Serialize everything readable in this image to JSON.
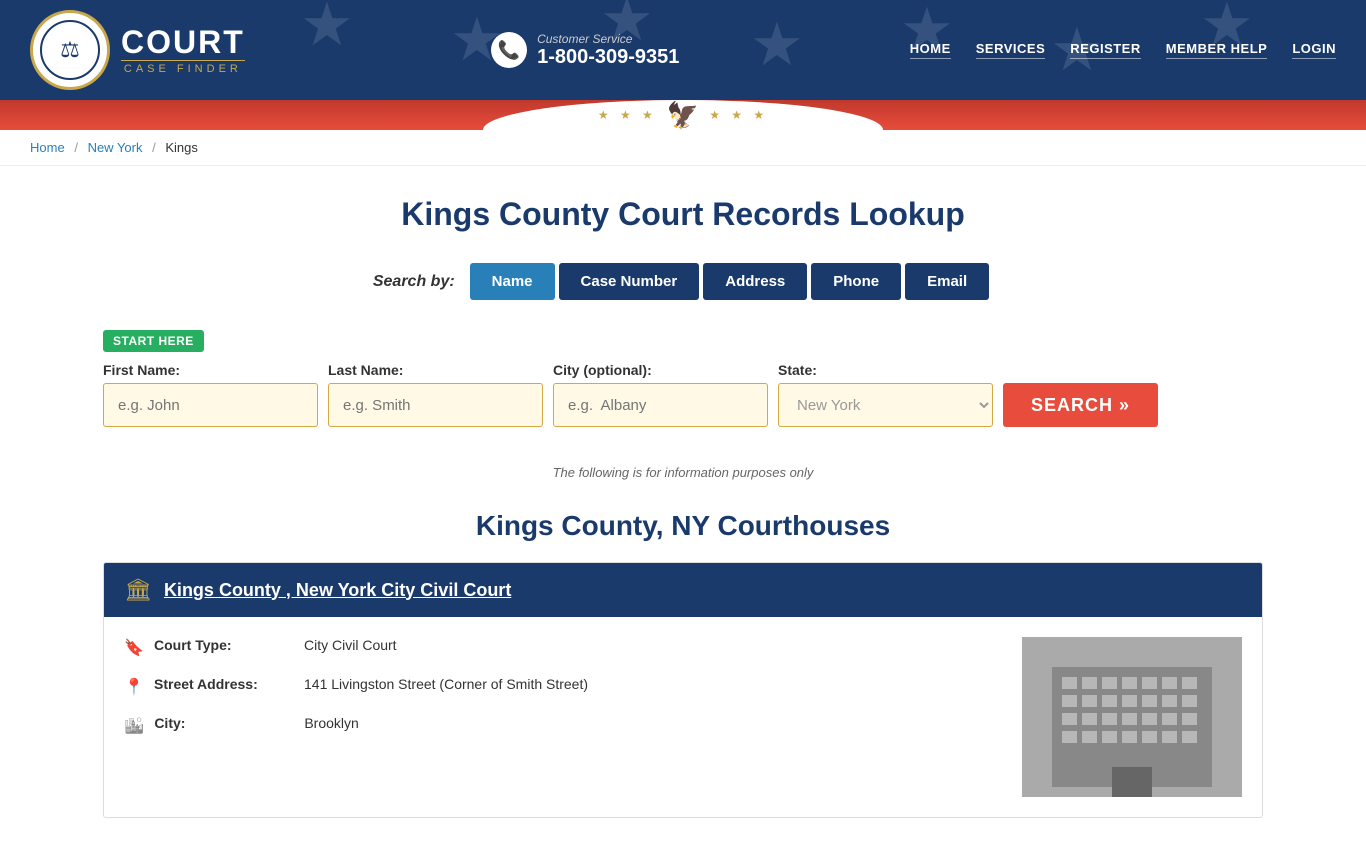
{
  "header": {
    "logo_court": "COURT",
    "logo_case_finder": "CASE FINDER",
    "customer_service_label": "Customer Service",
    "customer_service_number": "1-800-309-9351",
    "nav": [
      {
        "label": "HOME",
        "href": "#"
      },
      {
        "label": "SERVICES",
        "href": "#"
      },
      {
        "label": "REGISTER",
        "href": "#"
      },
      {
        "label": "MEMBER HELP",
        "href": "#"
      },
      {
        "label": "LOGIN",
        "href": "#"
      }
    ]
  },
  "breadcrumb": {
    "home": "Home",
    "state": "New York",
    "county": "Kings"
  },
  "main": {
    "page_title": "Kings County Court Records Lookup",
    "search_by_label": "Search by:",
    "search_tabs": [
      {
        "label": "Name",
        "active": true
      },
      {
        "label": "Case Number",
        "active": false
      },
      {
        "label": "Address",
        "active": false
      },
      {
        "label": "Phone",
        "active": false
      },
      {
        "label": "Email",
        "active": false
      }
    ],
    "start_here": "START HERE",
    "form": {
      "first_name_label": "First Name:",
      "first_name_placeholder": "e.g. John",
      "last_name_label": "Last Name:",
      "last_name_placeholder": "e.g. Smith",
      "city_label": "City (optional):",
      "city_placeholder": "e.g.  Albany",
      "state_label": "State:",
      "state_value": "New York",
      "search_button": "SEARCH »"
    },
    "info_note": "The following is for information purposes only",
    "courthouses_title": "Kings County, NY Courthouses",
    "courthouse": {
      "name": "Kings County , New York City Civil Court",
      "court_type_label": "Court Type:",
      "court_type_value": "City Civil Court",
      "street_address_label": "Street Address:",
      "street_address_value": "141 Livingston Street (Corner of Smith Street)",
      "city_label": "City:",
      "city_value": "Brooklyn"
    }
  }
}
